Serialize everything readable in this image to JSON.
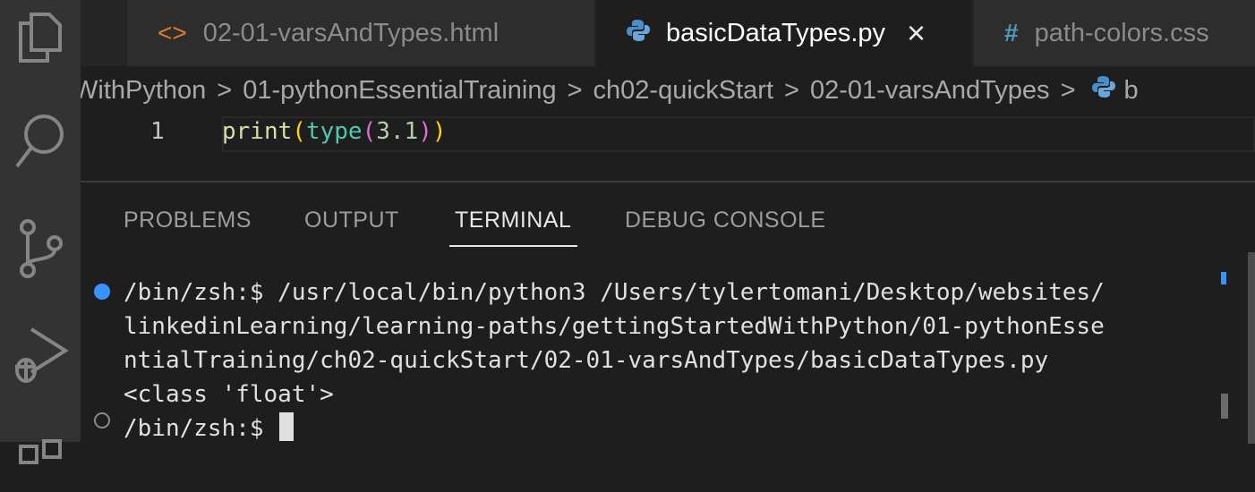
{
  "activity_bar": {
    "icons": [
      "files-icon",
      "search-icon",
      "source-control-icon",
      "run-debug-icon",
      "extensions-icon"
    ]
  },
  "tabs": [
    {
      "label": "02-01-varsAndTypes.html",
      "icon": "<>",
      "active": false
    },
    {
      "label": "basicDataTypes.py",
      "icon": "python-icon",
      "active": true,
      "close": "×"
    },
    {
      "label": "path-colors.css",
      "icon": "#",
      "active": false
    }
  ],
  "breadcrumb": {
    "items": [
      "WithPython",
      "01-pythonEssentialTraining",
      "ch02-quickStart",
      "02-01-varsAndTypes",
      "b"
    ],
    "separator": ">"
  },
  "editor": {
    "line_number": "1",
    "code_tokens": [
      {
        "text": "print",
        "color": "#dcdcaa"
      },
      {
        "text": "(",
        "color": "#ffd700"
      },
      {
        "text": "type",
        "color": "#4ec9b0"
      },
      {
        "text": "(",
        "color": "#da70d6"
      },
      {
        "text": "3.1",
        "color": "#b5cea8"
      },
      {
        "text": ")",
        "color": "#da70d6"
      },
      {
        "text": ")",
        "color": "#ffd700"
      }
    ]
  },
  "panel": {
    "tabs": [
      "PROBLEMS",
      "OUTPUT",
      "TERMINAL",
      "DEBUG CONSOLE"
    ],
    "active_tab": "TERMINAL"
  },
  "terminal": {
    "lines": [
      "/bin/zsh:$ /usr/local/bin/python3 /Users/tylertomani/Desktop/websites/",
      "linkedinLearning/learning-paths/gettingStartedWithPython/01-pythonEsse",
      "ntialTraining/ch02-quickStart/02-01-varsAndTypes/basicDataTypes.py",
      "<class 'float'>"
    ],
    "prompt": "/bin/zsh:$ "
  }
}
